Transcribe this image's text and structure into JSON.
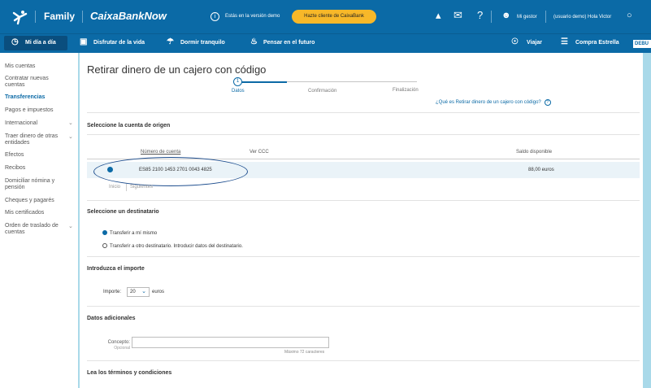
{
  "header": {
    "family": "Family",
    "brand": "CaixaBankNow",
    "demo_notice": "Estás en la versión demo",
    "client_button": "Hazte cliente de CaixaBank",
    "gestor": "Mi gestor",
    "user": "(usuario demo) Hola Victor"
  },
  "nav": {
    "items": [
      "Mi día a día",
      "Disfrutar de la vida",
      "Dormir tranquilo",
      "Pensar en el futuro",
      "Viajar",
      "Compra Estrella"
    ],
    "debug": "DEBU"
  },
  "sidebar": {
    "items": [
      "Mis cuentas",
      "Contratar nuevas",
      "cuentas",
      "Transferencias",
      "Pagos e impuestos",
      "Internacional",
      "Traer dinero de otras",
      "entidades",
      "Efectos",
      "Recibos",
      "Domiciliar nómina y",
      "pensión",
      "Cheques y pagarés",
      "Mis certificados",
      "Orden de traslado de",
      "cuentas"
    ]
  },
  "page": {
    "title": "Retirar dinero de un cajero con código",
    "steps": [
      "Datos",
      "Confirmación",
      "Finalización"
    ],
    "step_number": "1",
    "help_link": "¿Qué es Retirar dinero de un cajero con código?",
    "section_origin": "Seleccione la cuenta de origen",
    "columns": [
      "Número de cuenta",
      "Ver CCC",
      "Saldo disponible"
    ],
    "account": {
      "number": "ES85 2100 1453 2701 0043 4825",
      "balance": "88,00 euros"
    },
    "pager": [
      "Inicio",
      "Siguientes"
    ],
    "section_recipient": "Seleccione un destinatario",
    "recipient_options": [
      "Transferir a mí mismo",
      "Transferir a otro destinatario. Introducir datos del destinatario."
    ],
    "section_amount": "Introduzca el importe",
    "amount_label": "Importe:",
    "amount_value": "20",
    "amount_unit": "euros",
    "section_extra": "Datos adicionales",
    "concept_label": "Concepto:",
    "concept_optional": "Opcional",
    "concept_max": "Máximo 72 caracteres",
    "section_terms": "Lea los términos y condiciones"
  },
  "colors": {
    "primary": "#0b6aa6",
    "accent": "#f7b829",
    "background": "#a9d9e9"
  }
}
